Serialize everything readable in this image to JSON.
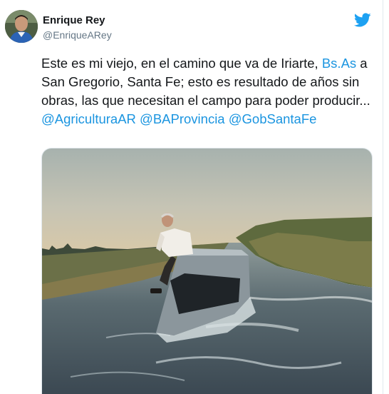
{
  "author": {
    "name": "Enrique Rey",
    "handle": "@EnriqueARey"
  },
  "icons": {
    "platform": "twitter-bird-icon",
    "avatar": "avatar"
  },
  "colors": {
    "link": "#1b95e0",
    "text": "#14171a",
    "muted": "#657786",
    "bird": "#1da1f2"
  },
  "tweet": {
    "text_1": "Este es mi viejo, en el camino que va de Iriarte, ",
    "link_1": "Bs.As",
    "text_2": " a San Gregorio, Santa Fe; esto es resultado de años sin obras, las que necesitan el campo para poder producir... ",
    "mention_1": "@AgriculturaAR",
    "text_3": " ",
    "mention_2": "@BAProvincia",
    "text_4": " ",
    "mention_3": "@GobSantaFe"
  },
  "media": {
    "kind": "photo"
  }
}
